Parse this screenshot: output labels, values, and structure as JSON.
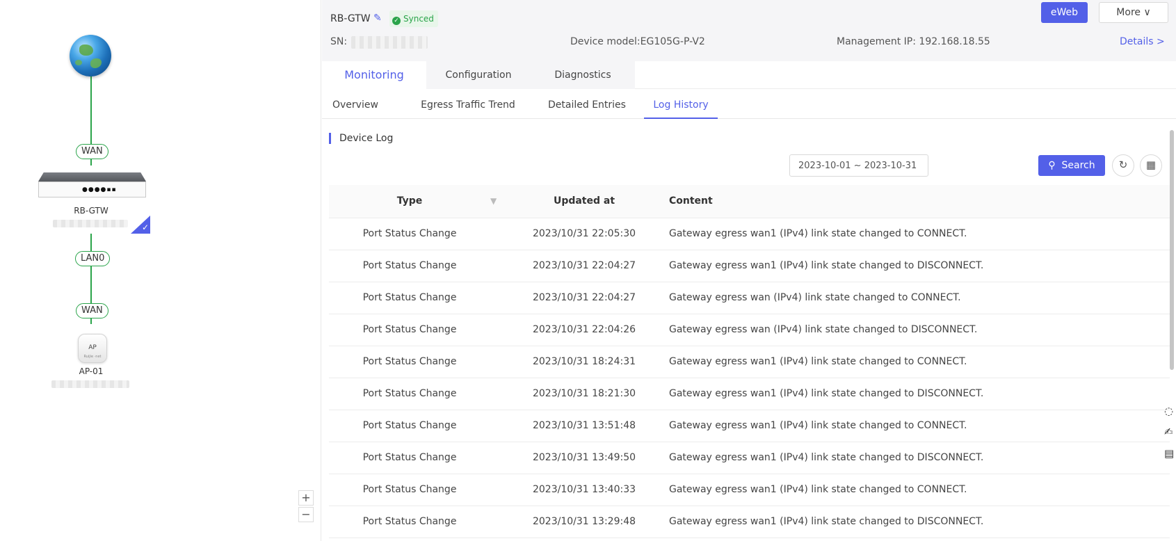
{
  "topology": {
    "wan_top": "WAN",
    "gateway_name": "RB-GTW",
    "gateway_leds": "●●●●▪▪",
    "lan_port": "LAN0",
    "wan_bottom": "WAN",
    "ap_badge": "AP",
    "ap_brand": "Ruijie ·net",
    "ap_name": "AP-01",
    "zoom_in": "+",
    "zoom_out": "−"
  },
  "device": {
    "name": "RB-GTW",
    "status": "Synced",
    "sn_label": "SN:",
    "model": "Device model:EG105G-P-V2",
    "management_ip": "Management IP:  192.168.18.55",
    "details_link": "Details >",
    "eweb_button": "eWeb",
    "more_button": "More  ∨"
  },
  "main_tabs": [
    "Monitoring",
    "Configuration",
    "Diagnostics"
  ],
  "sub_tabs": [
    "Overview",
    "Egress Traffic Trend",
    "Detailed Entries",
    "Log History"
  ],
  "log": {
    "section_title": "Device Log",
    "date_range": "2023-10-01 ~ 2023-10-31",
    "search_button": "Search",
    "columns": {
      "type": "Type",
      "updated_at": "Updated at",
      "content": "Content"
    },
    "rows": [
      {
        "type": "Port Status Change",
        "time": "2023/10/31 22:05:30",
        "content": "Gateway egress wan1 (IPv4) link state changed to CONNECT."
      },
      {
        "type": "Port Status Change",
        "time": "2023/10/31 22:04:27",
        "content": "Gateway egress wan1 (IPv4) link state changed to DISCONNECT."
      },
      {
        "type": "Port Status Change",
        "time": "2023/10/31 22:04:27",
        "content": "Gateway egress wan (IPv4) link state changed to CONNECT."
      },
      {
        "type": "Port Status Change",
        "time": "2023/10/31 22:04:26",
        "content": "Gateway egress wan (IPv4) link state changed to DISCONNECT."
      },
      {
        "type": "Port Status Change",
        "time": "2023/10/31 18:24:31",
        "content": "Gateway egress wan1 (IPv4) link state changed to CONNECT."
      },
      {
        "type": "Port Status Change",
        "time": "2023/10/31 18:21:30",
        "content": "Gateway egress wan1 (IPv4) link state changed to DISCONNECT."
      },
      {
        "type": "Port Status Change",
        "time": "2023/10/31 13:51:48",
        "content": "Gateway egress wan1 (IPv4) link state changed to CONNECT."
      },
      {
        "type": "Port Status Change",
        "time": "2023/10/31 13:49:50",
        "content": "Gateway egress wan1 (IPv4) link state changed to DISCONNECT."
      },
      {
        "type": "Port Status Change",
        "time": "2023/10/31 13:40:33",
        "content": "Gateway egress wan1 (IPv4) link state changed to CONNECT."
      },
      {
        "type": "Port Status Change",
        "time": "2023/10/31 13:29:48",
        "content": "Gateway egress wan1 (IPv4) link state changed to DISCONNECT."
      }
    ]
  },
  "colors": {
    "accent": "#5360e8",
    "online": "#2aa44a"
  }
}
